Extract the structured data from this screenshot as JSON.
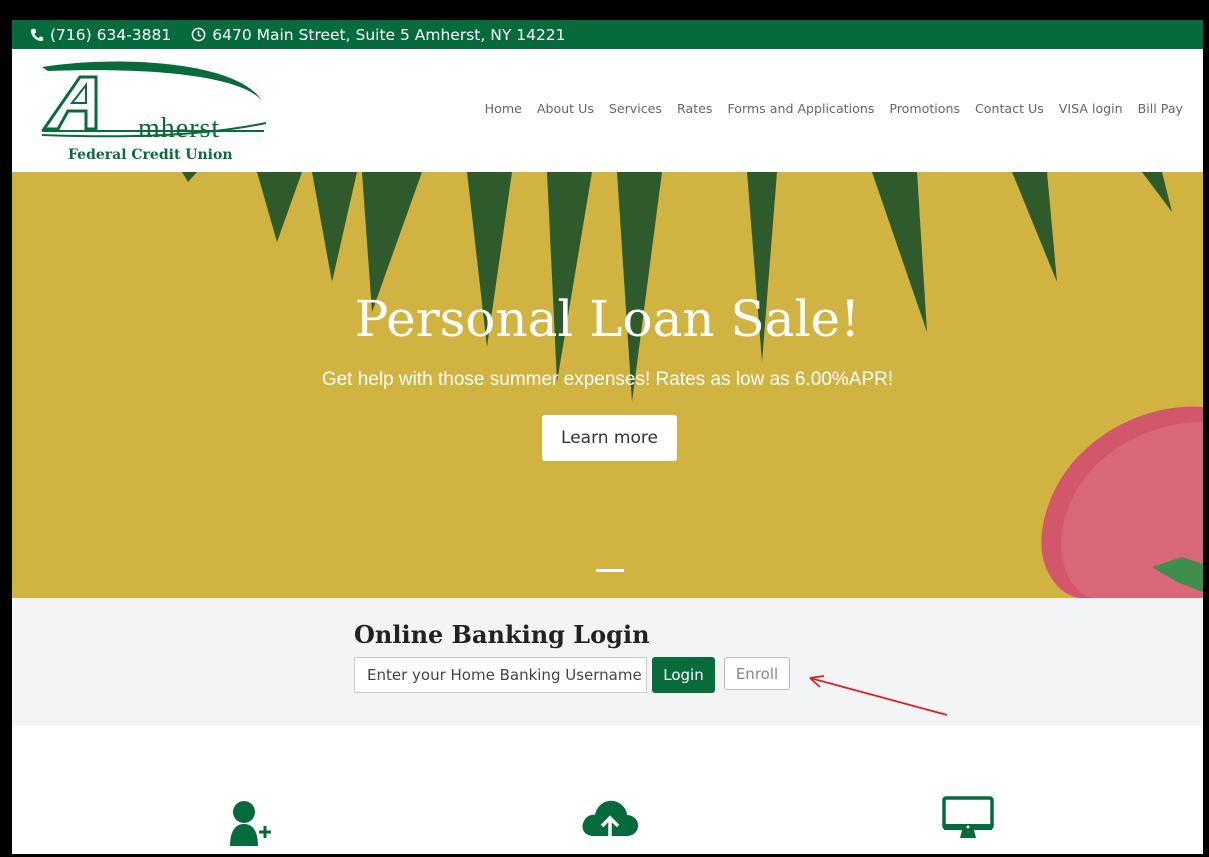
{
  "topbar": {
    "phone": "(716) 634-3881",
    "address": "6470 Main Street, Suite 5 Amherst, NY 14221",
    "phone_icon": "phone-icon",
    "clock_icon": "clock-icon"
  },
  "logo": {
    "initial": "A",
    "word": "mherst",
    "subtitle": "Federal Credit Union"
  },
  "nav": {
    "items": [
      {
        "label": "Home"
      },
      {
        "label": "About Us"
      },
      {
        "label": "Services"
      },
      {
        "label": "Rates"
      },
      {
        "label": "Forms and Applications"
      },
      {
        "label": "Promotions"
      },
      {
        "label": "Contact Us"
      },
      {
        "label": "VISA login"
      },
      {
        "label": "Bill Pay"
      }
    ]
  },
  "hero": {
    "title": "Personal Loan Sale!",
    "subtitle": "Get help with those summer expenses! Rates as low as 6.00%APR!",
    "button_label": "Learn more"
  },
  "login": {
    "title": "Online Banking Login",
    "username_placeholder": "Enter your Home Banking Username",
    "login_label": "Login",
    "enroll_label": "Enroll"
  },
  "features": {
    "icons": [
      "add-user-icon",
      "cloud-upload-icon",
      "monitor-icon"
    ]
  },
  "colors": {
    "brand_green": "#066b3c",
    "hero_yellow": "#d1b341",
    "annotation_red": "#e02020"
  }
}
